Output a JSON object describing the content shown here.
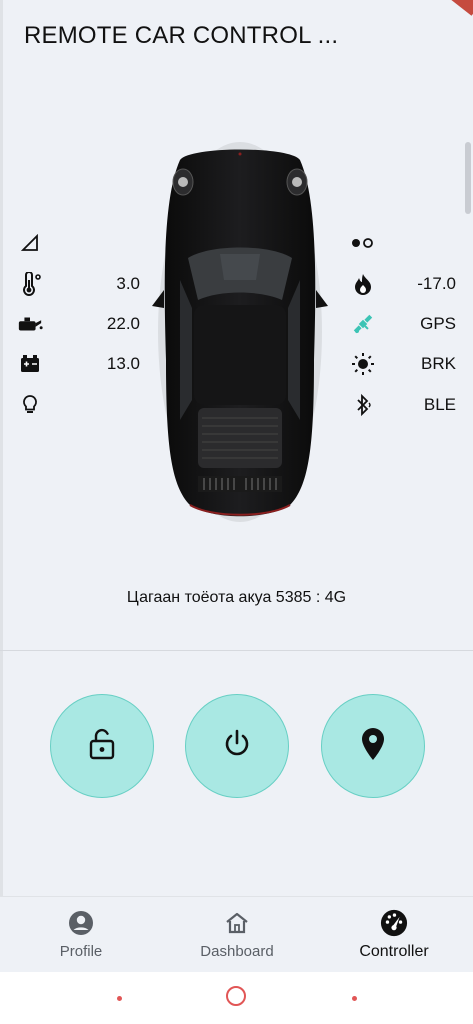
{
  "header": {
    "title": "REMOTE CAR CONTROL ..."
  },
  "left_stats": [
    {
      "icon": "signal-icon",
      "value": ""
    },
    {
      "icon": "thermometer-icon",
      "value": "3.0"
    },
    {
      "icon": "oil-icon",
      "value": "22.0"
    },
    {
      "icon": "battery-icon",
      "value": "13.0"
    },
    {
      "icon": "lightbulb-icon",
      "value": ""
    }
  ],
  "right_stats": [
    {
      "icon": "toggle-dots-icon",
      "value": ""
    },
    {
      "icon": "flame-icon",
      "value": "-17.0"
    },
    {
      "icon": "satellite-icon",
      "value": "GPS",
      "color": "#3cc4b5"
    },
    {
      "icon": "sun-icon",
      "value": "BRK"
    },
    {
      "icon": "bluetooth-icon",
      "value": "BLE"
    }
  ],
  "vehicle": {
    "caption": "Цагаан тоёота акуа 5385 : 4G"
  },
  "controls": [
    {
      "name": "unlock",
      "icon": "unlock-icon"
    },
    {
      "name": "power",
      "icon": "power-icon"
    },
    {
      "name": "location",
      "icon": "location-pin-icon"
    }
  ],
  "bottom_nav": {
    "items": [
      {
        "label": "Profile",
        "icon": "account-circle-icon",
        "active": false
      },
      {
        "label": "Dashboard",
        "icon": "home-icon",
        "active": false
      },
      {
        "label": "Controller",
        "icon": "speedometer-icon",
        "active": true
      }
    ]
  },
  "colors": {
    "accent": "#a9e8e3",
    "accent_border": "#67cfc4",
    "background": "#eef1f6",
    "gps": "#3cc4b5"
  }
}
